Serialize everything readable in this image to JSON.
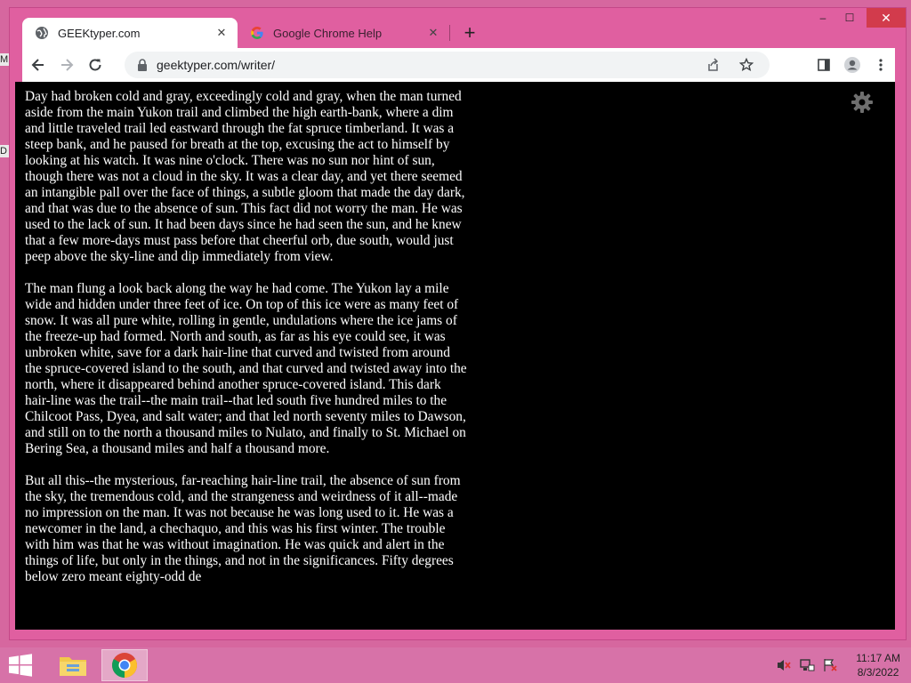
{
  "desktop": {
    "frag1": "M",
    "frag2": "D"
  },
  "browser": {
    "tabs": [
      {
        "label": "GEEKtyper.com",
        "icon": "globe-icon",
        "active": true
      },
      {
        "label": "Google Chrome Help",
        "icon": "google-icon",
        "active": false
      }
    ],
    "new_tab": "+",
    "url": "geektyper.com/writer/",
    "window_controls": {
      "minimize": "–",
      "maximize": "☐",
      "close": "✕"
    }
  },
  "page": {
    "background": "#000000",
    "text_color": "#ffffff",
    "paragraphs": [
      "Day had broken cold and gray, exceedingly cold and gray, when the man turned aside from the main Yukon trail and climbed the high earth-bank, where a dim and little traveled trail led eastward through the fat spruce timberland. It was a steep bank, and he paused for breath at the top, excusing the act to himself by looking at his watch. It was nine o'clock. There was no sun nor hint of sun, though there was not a cloud in the sky. It was a clear day, and yet there seemed an intangible pall over the face of things, a subtle gloom that made the day dark, and that was due to the absence of sun. This fact did not worry the man. He was used to the lack of sun. It had been days since he had seen the sun, and he knew that a few more-days must pass before that cheerful orb, due south, would just peep above the sky-line and dip immediately from view.",
      "The man flung a look back along the way he had come. The Yukon lay a mile wide and hidden under three feet of ice. On top of this ice were as many feet of snow. It was all pure white, rolling in gentle, undulations where the ice jams of the freeze-up had formed. North and south, as far as his eye could see, it was unbroken white, save for a dark hair-line that curved and twisted from around the spruce-covered island to the south, and that curved and twisted away into the north, where it disappeared behind another spruce-covered island. This dark hair-line was the trail--the main trail--that led south five hundred miles to the Chilcoot Pass, Dyea, and salt water; and that led north seventy miles to Dawson, and still on to the north a thousand miles to Nulato, and finally to St. Michael on Bering Sea, a thousand miles and half a thousand more.",
      "But all this--the mysterious, far-reaching hair-line trail, the absence of sun from the sky, the tremendous cold, and the strangeness and weirdness of it all--made no impression on the man. It was not because he was long used to it. He was a newcomer in the land, a chechaquo, and this was his first winter. The trouble with him was that he was without imagination. He was quick and alert in the things of life, but only in the things, and not in the significances. Fifty degrees below zero meant eighty-odd de"
    ]
  },
  "taskbar": {
    "time": "11:17 AM",
    "date": "8/3/2022",
    "apps": [
      "file-explorer-icon",
      "chrome-icon"
    ]
  },
  "colors": {
    "accent_pink": "#e05fa0",
    "taskbar": "#d772a8",
    "close_red": "#d23b4c"
  }
}
